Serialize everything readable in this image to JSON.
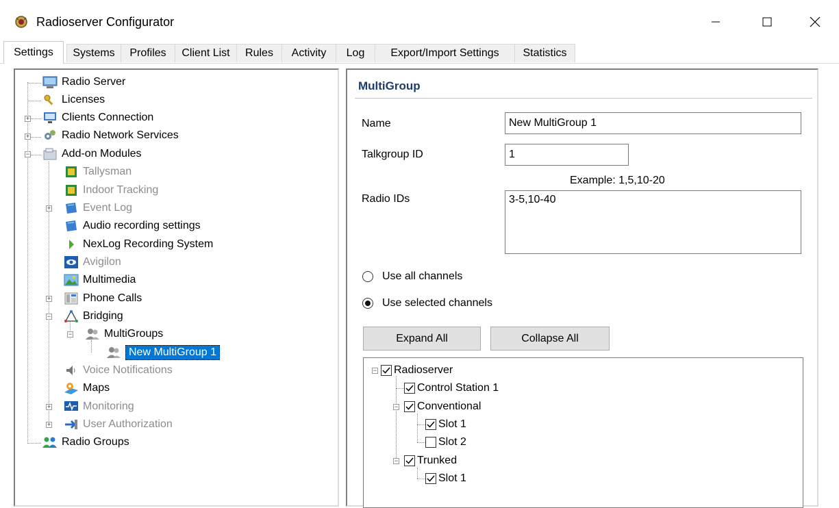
{
  "window": {
    "title": "Radioserver Configurator",
    "minimize_glyph": "—",
    "maximize_glyph": "☐",
    "close_glyph": "✕"
  },
  "tabs": [
    {
      "label": "Settings",
      "active": true
    },
    {
      "label": "Systems"
    },
    {
      "label": "Profiles"
    },
    {
      "label": "Client List"
    },
    {
      "label": "Rules"
    },
    {
      "label": "Activity"
    },
    {
      "label": "Log"
    },
    {
      "label": "Export/Import Settings"
    },
    {
      "label": "Statistics"
    }
  ],
  "tree": {
    "radio_server": {
      "label": "Radio Server",
      "icon": "radio-server-icon"
    },
    "licenses": {
      "label": "Licenses",
      "icon": "key-icon"
    },
    "clients_connection": {
      "label": "Clients Connection",
      "icon": "network-icon"
    },
    "radio_network_services": {
      "label": "Radio Network Services",
      "icon": "gears-icon"
    },
    "addon_modules": {
      "label": "Add-on Modules",
      "icon": "modules-icon"
    },
    "tallysman": {
      "label": "Tallysman",
      "icon": "chip-icon",
      "disabled": true
    },
    "indoor_tracking": {
      "label": "Indoor Tracking",
      "icon": "chip-icon",
      "disabled": true
    },
    "event_log": {
      "label": "Event Log",
      "icon": "blue-sheet-icon",
      "disabled": true
    },
    "audio_recording": {
      "label": "Audio recording settings",
      "icon": "blue-sheet-icon"
    },
    "nexlog": {
      "label": "NexLog Recording System",
      "icon": "green-arrow-icon"
    },
    "avigilon": {
      "label": "Avigilon",
      "icon": "eye-icon",
      "disabled": true
    },
    "multimedia": {
      "label": "Multimedia",
      "icon": "picture-icon"
    },
    "phone_calls": {
      "label": "Phone Calls",
      "icon": "phone-icon"
    },
    "bridging": {
      "label": "Bridging",
      "icon": "bridge-icon"
    },
    "multigroups": {
      "label": "MultiGroups",
      "icon": "users-icon"
    },
    "new_multigroup": {
      "label": "New MultiGroup 1",
      "icon": "users-icon",
      "selected": true
    },
    "voice_notifications": {
      "label": "Voice Notifications",
      "icon": "speaker-icon",
      "disabled": true
    },
    "maps": {
      "label": "Maps",
      "icon": "map-icon"
    },
    "monitoring": {
      "label": "Monitoring",
      "icon": "monitor-icon",
      "disabled": true
    },
    "user_authorization": {
      "label": "User Authorization",
      "icon": "arrow-login-icon",
      "disabled": true
    },
    "radio_groups": {
      "label": "Radio Groups",
      "icon": "people-icon"
    }
  },
  "form": {
    "section_title": "MultiGroup",
    "name_label": "Name",
    "name_value": "New MultiGroup 1",
    "talkgroup_label": "Talkgroup ID",
    "talkgroup_value": "1",
    "example_hint": "Example: 1,5,10-20",
    "radio_ids_label": "Radio IDs",
    "radio_ids_value": "3-5,10-40",
    "use_all_label": "Use all channels",
    "use_selected_label": "Use selected channels",
    "selected_option": "use_selected",
    "expand_all_label": "Expand All",
    "collapse_all_label": "Collapse All"
  },
  "channels": {
    "radioserver": {
      "label": "Radioserver",
      "checked": true
    },
    "control_station": {
      "label": "Control Station 1",
      "checked": true
    },
    "conventional": {
      "label": "Conventional",
      "checked": true
    },
    "conv_slot1": {
      "label": "Slot 1",
      "checked": true
    },
    "conv_slot2": {
      "label": "Slot 2",
      "checked": false
    },
    "trunked": {
      "label": "Trunked",
      "checked": true
    },
    "trunk_slot1": {
      "label": "Slot 1",
      "checked": true
    }
  },
  "colors": {
    "selection": "#0078d7",
    "section_title": "#1f3b6e",
    "disabled_text": "#8c8c8c"
  }
}
